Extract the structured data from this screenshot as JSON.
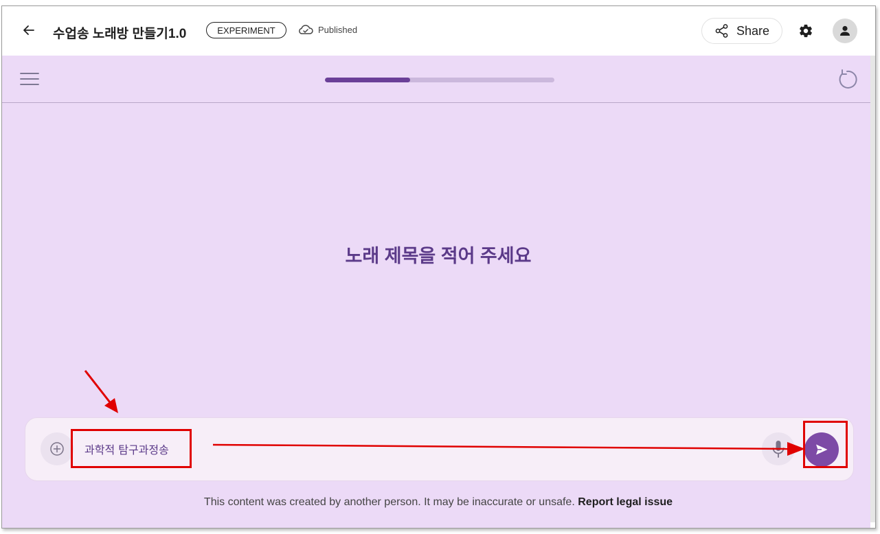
{
  "header": {
    "title": "수업송 노래방 만들기1.0",
    "badge": "EXPERIMENT",
    "status": "Published",
    "share_label": "Share"
  },
  "app": {
    "progress": 0.37,
    "prompt_title": "노래 제목을 적어 주세요"
  },
  "input": {
    "value": "과학적 탐구과정송"
  },
  "footer": {
    "disclaimer": "This content was created by another person. It may be inaccurate or unsafe.",
    "report_link": "Report legal issue"
  },
  "colors": {
    "accent": "#7d4aa6",
    "app_background": "#ecdaf7",
    "annotation": "#e00000"
  },
  "icons": [
    "back-arrow-icon",
    "cloud-check-icon",
    "share-icon",
    "gear-icon",
    "person-icon",
    "hamburger-menu-icon",
    "refresh-icon",
    "add-circle-icon",
    "microphone-icon",
    "send-icon"
  ]
}
